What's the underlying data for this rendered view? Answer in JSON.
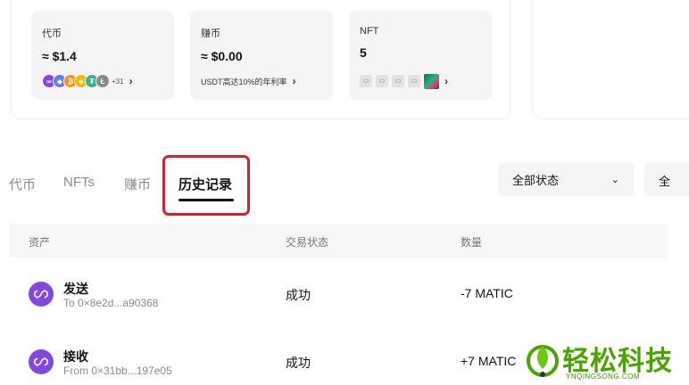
{
  "summary": {
    "tokens": {
      "title": "代币",
      "value": "≈ $1.4",
      "extra_count": "+31"
    },
    "earn": {
      "title": "赚币",
      "value": "≈ $0.00",
      "link": "USDT高达10%的年利率"
    },
    "nft": {
      "title": "NFT",
      "value": "5"
    }
  },
  "tabs": [
    {
      "label": "代币"
    },
    {
      "label": "NFTs"
    },
    {
      "label": "赚币"
    },
    {
      "label": "历史记录"
    }
  ],
  "filters": {
    "status_label": "全部状态",
    "second_label": "全"
  },
  "table": {
    "headers": {
      "asset": "资产",
      "status": "交易状态",
      "amount": "数量"
    },
    "rows": [
      {
        "type": "发送",
        "address": "To 0×8e2d...a90368",
        "status": "成功",
        "amount": "-7 MATIC"
      },
      {
        "type": "接收",
        "address": "From 0×31bb...197e05",
        "status": "成功",
        "amount": "+7 MATIC"
      }
    ]
  },
  "watermark": {
    "title": "轻松科技",
    "subtitle": "YNQINGSONG.COM"
  },
  "colors": {
    "accent_highlight": "#d6202b",
    "matic_purple": "#8247e5",
    "watermark_green": "#4aa300"
  }
}
